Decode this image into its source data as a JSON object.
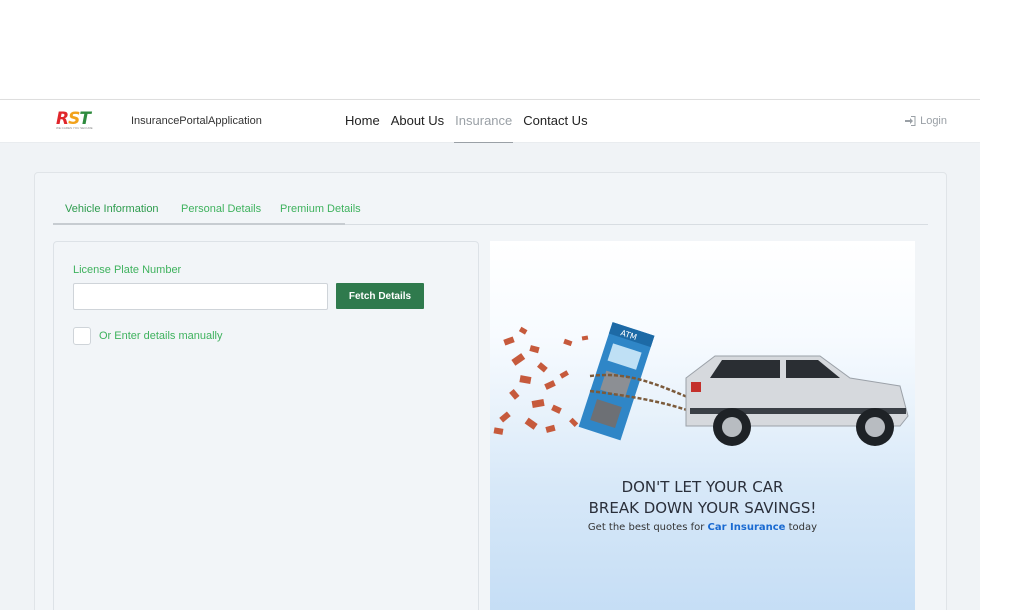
{
  "navbar": {
    "logo": {
      "letters": [
        "R",
        "S",
        "T"
      ],
      "tagline": "WE CARES YOU SECURE"
    },
    "app_name": "InsurancePortalApplication",
    "links": [
      {
        "label": "Home",
        "active": false
      },
      {
        "label": "About Us",
        "active": false
      },
      {
        "label": "Insurance",
        "active": true
      },
      {
        "label": "Contact Us",
        "active": false
      }
    ],
    "login_label": "Login"
  },
  "tabs": [
    {
      "label": "Vehicle Information",
      "active": true
    },
    {
      "label": "Personal Details",
      "active": false
    },
    {
      "label": "Premium Details",
      "active": false
    }
  ],
  "form": {
    "license_label": "License Plate Number",
    "license_value": "",
    "fetch_button": "Fetch Details",
    "manual_label": "Or Enter details manually",
    "manual_checked": false
  },
  "promo": {
    "atm_label": "ATM",
    "headline_1": "DON'T LET YOUR CAR",
    "headline_2": "BREAK DOWN YOUR SAVINGS!",
    "sub_prefix": "Get the best quotes for ",
    "sub_highlight": "Car Insurance",
    "sub_suffix": " today"
  },
  "colors": {
    "accent_green": "#3fb25e",
    "button_green": "#2f7a4d",
    "highlight_blue": "#1a6ad1",
    "muted": "#9aa0a6"
  }
}
